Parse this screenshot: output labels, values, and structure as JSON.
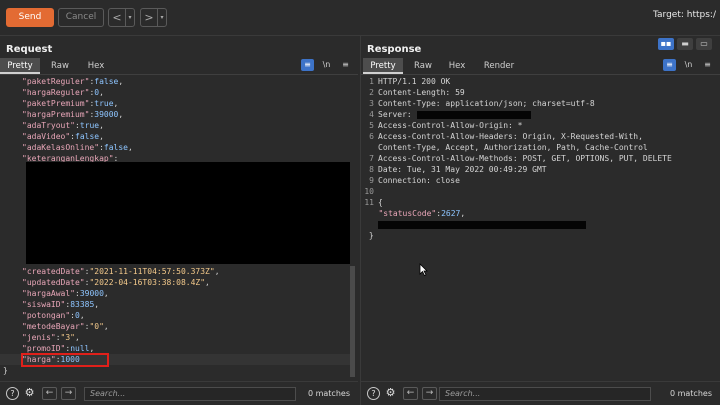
{
  "toolbar": {
    "send_label": "Send",
    "cancel_label": "Cancel",
    "back_glyph": "<",
    "forward_glyph": ">",
    "dropdown_glyph": "▾",
    "target_text": "Target: https:/"
  },
  "request": {
    "title": "Request",
    "tabs": [
      "Pretty",
      "Raw",
      "Hex"
    ],
    "active_tab": "Pretty",
    "newline_toggle": "\\n",
    "menu_glyph": "≡",
    "lines_top": [
      {
        "key": "\"paketReguler\"",
        "value": "false",
        "kind": "n"
      },
      {
        "key": "\"hargaReguler\"",
        "value": "0",
        "kind": "n"
      },
      {
        "key": "\"paketPremium\"",
        "value": "true",
        "kind": "n"
      },
      {
        "key": "\"hargaPremium\"",
        "value": "39000",
        "kind": "n"
      },
      {
        "key": "\"adaTryout\"",
        "value": "true",
        "kind": "n"
      },
      {
        "key": "\"adaVideo\"",
        "value": "false",
        "kind": "n"
      },
      {
        "key": "\"adaKelasOnline\"",
        "value": "false",
        "kind": "n"
      },
      {
        "key": "\"keteranganLengkap\"",
        "value": "",
        "kind": "n"
      }
    ],
    "lines_bottom": [
      {
        "key": "\"createdDate\"",
        "value": "\"2021-11-11T04:57:50.373Z\"",
        "kind": "s"
      },
      {
        "key": "\"updatedDate\"",
        "value": "\"2022-04-16T03:38:08.4Z\"",
        "kind": "s"
      },
      {
        "key": "\"hargaAwal\"",
        "value": "39000",
        "kind": "n"
      },
      {
        "key": "\"siswaID\"",
        "value": "83385",
        "kind": "n"
      },
      {
        "key": "\"potongan\"",
        "value": "0",
        "kind": "n"
      },
      {
        "key": "\"metodeBayar\"",
        "value": "\"0\"",
        "kind": "s"
      },
      {
        "key": "\"jenis\"",
        "value": "\"3\"",
        "kind": "s"
      },
      {
        "key": "\"promoID\"",
        "value": "null",
        "kind": "n"
      },
      {
        "key": "\"harga\"",
        "value": "1000",
        "kind": "n"
      }
    ],
    "closing_brace": "}",
    "search_placeholder": "Search...",
    "matches": "0 matches"
  },
  "response": {
    "title": "Response",
    "tabs": [
      "Pretty",
      "Raw",
      "Hex",
      "Render"
    ],
    "active_tab": "Pretty",
    "newline_toggle": "\\n",
    "menu_glyph": "≡",
    "lines": [
      {
        "num": "1",
        "text": "HTTP/1.1 200 OK"
      },
      {
        "num": "2",
        "text": "Content-Length: 59"
      },
      {
        "num": "3",
        "text": "Content-Type: application/json; charset=utf-8"
      },
      {
        "num": "4",
        "text": "Server: "
      },
      {
        "num": "5",
        "text": "Access-Control-Allow-Origin: *"
      },
      {
        "num": "6",
        "text": "Access-Control-Allow-Headers: Origin, X-Requested-With,"
      },
      {
        "num": "",
        "text": "Content-Type, Accept, Authorization, Path, Cache-Control"
      },
      {
        "num": "7",
        "text": "Access-Control-Allow-Methods: POST, GET, OPTIONS, PUT, DELETE"
      },
      {
        "num": "8",
        "text": "Date: Tue, 31 May 2022 00:49:29 GMT"
      },
      {
        "num": "9",
        "text": "Connection: close"
      },
      {
        "num": "10",
        "text": ""
      },
      {
        "num": "11",
        "text": "{"
      }
    ],
    "status_key": "\"statusCode\"",
    "status_value": "2627",
    "closing_brace": "}",
    "search_placeholder": "Search...",
    "matches": "0 matches"
  },
  "colors": {
    "send": "#e36b33",
    "highlight_box": "#e0201a",
    "active_icon": "#3d73c8"
  },
  "icons": [
    "help-icon",
    "settings-icon",
    "back-arrow-icon",
    "forward-arrow-icon",
    "layout-icon",
    "wrap-icon",
    "menu-icon"
  ]
}
